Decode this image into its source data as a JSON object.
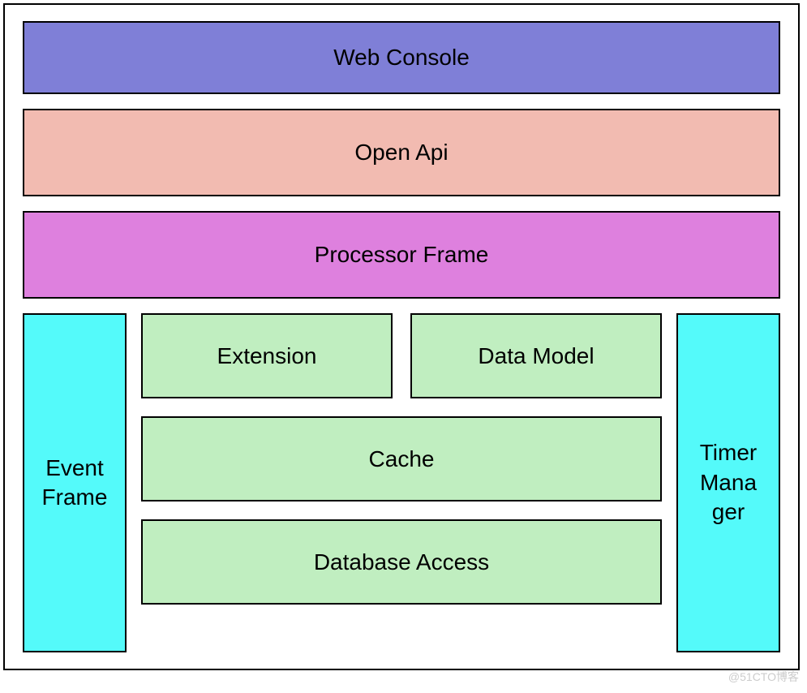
{
  "layers": {
    "web_console": "Web Console",
    "open_api": "Open Api",
    "processor_frame": "Processor Frame",
    "event_frame": "Event Frame",
    "timer_manager": "Timer Mana ger",
    "extension": "Extension",
    "data_model": "Data Model",
    "cache": "Cache",
    "database_access": "Database Access"
  },
  "colors": {
    "web_console": "#7f7fd7",
    "open_api": "#f2bbb1",
    "processor_frame": "#de80de",
    "event_frame": "#54fafa",
    "timer_manager": "#54fafa",
    "inner_boxes": "#c0eec0"
  },
  "watermark": "@51CTO博客"
}
